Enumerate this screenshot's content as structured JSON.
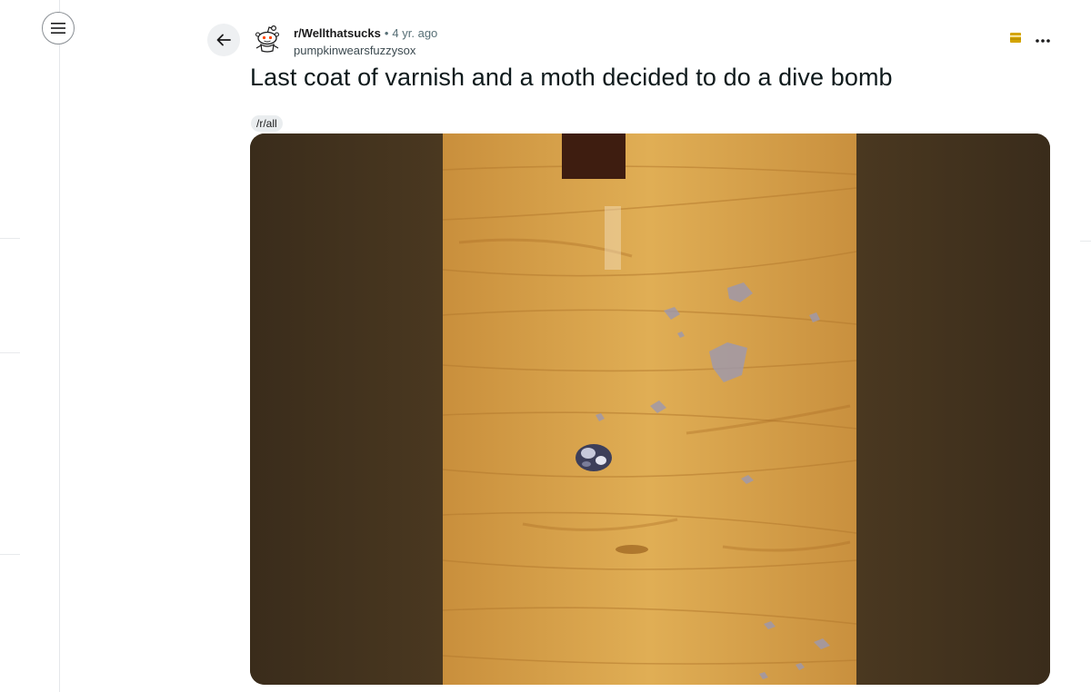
{
  "post": {
    "subreddit": "r/Wellthatsucks",
    "separator": "•",
    "age": "4 yr. ago",
    "author": "pumpkinwearsfuzzysox",
    "title": "Last coat of varnish and a moth decided to do a dive bomb",
    "flair": "/r/all"
  },
  "icons": {
    "menu": "hamburger-icon",
    "back": "arrow-left-icon",
    "avatar": "snoo-avatar-icon",
    "award": "award-icon",
    "overflow": "more-horizontal-icon"
  },
  "colors": {
    "award": "#d4a500",
    "backdrop": "#3b2e1c",
    "wood": "#d9a44c"
  }
}
